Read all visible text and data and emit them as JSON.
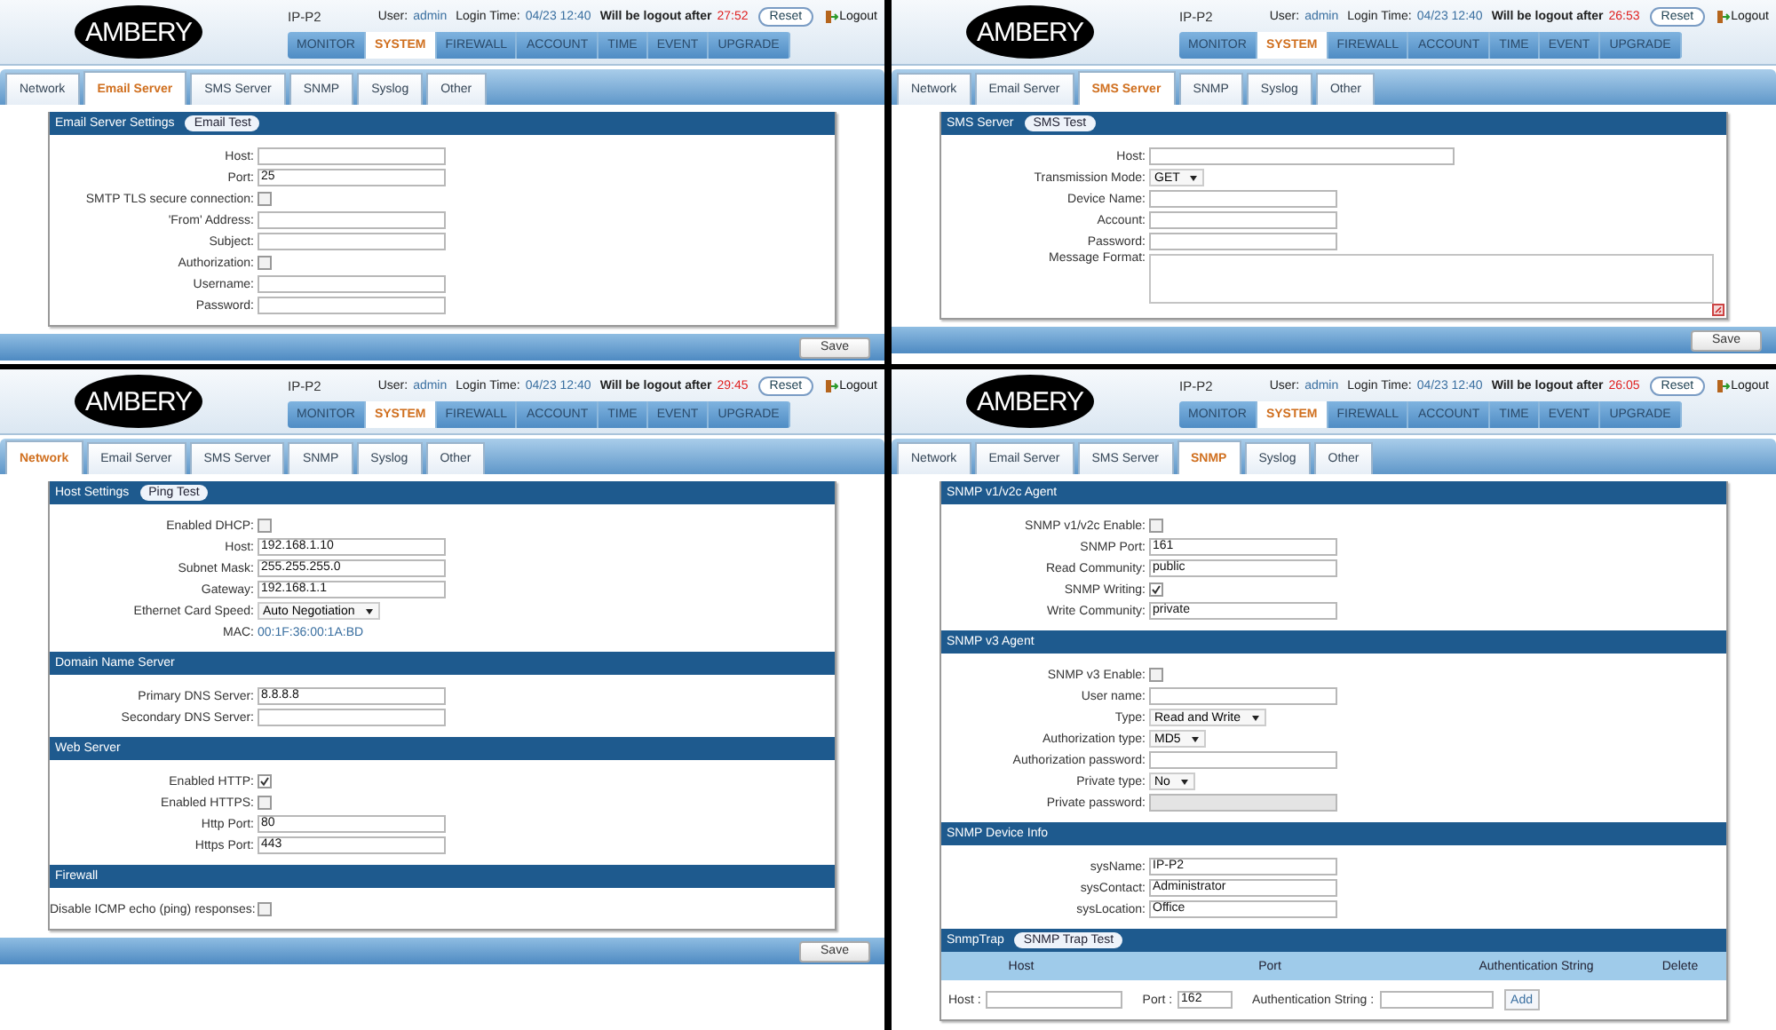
{
  "panels": [
    {
      "logo": "AMBERY",
      "product": "IP-P2",
      "user_label": "User:",
      "user": "admin",
      "login_label": "Login Time:",
      "login_time": "04/23 12:40",
      "logout_label": "Will be logout after",
      "countdown": "27:52",
      "reset": "Reset",
      "logout": "Logout",
      "menu": [
        {
          "label": "MONITOR",
          "selected": false
        },
        {
          "label": "SYSTEM",
          "selected": true
        },
        {
          "label": "FIREWALL",
          "selected": false
        },
        {
          "label": "ACCOUNT",
          "selected": false
        },
        {
          "label": "TIME",
          "selected": false
        },
        {
          "label": "EVENT",
          "selected": false
        },
        {
          "label": "UPGRADE",
          "selected": false
        }
      ],
      "tabs": [
        {
          "label": "Network",
          "selected": false
        },
        {
          "label": "Email Server",
          "selected": true
        },
        {
          "label": "SMS Server",
          "selected": false
        },
        {
          "label": "SNMP",
          "selected": false
        },
        {
          "label": "Syslog",
          "selected": false
        },
        {
          "label": "Other",
          "selected": false
        }
      ],
      "sections": [
        {
          "title": "Email Server Settings",
          "test_button": "Email Test",
          "rows": [
            {
              "kind": "text",
              "label": "Host:",
              "value": ""
            },
            {
              "kind": "text",
              "label": "Port:",
              "value": "25"
            },
            {
              "kind": "checkbox",
              "label": "SMTP TLS secure connection:",
              "checked": false
            },
            {
              "kind": "text",
              "label": "'From' Address:",
              "value": ""
            },
            {
              "kind": "text",
              "label": "Subject:",
              "value": ""
            },
            {
              "kind": "checkbox",
              "label": "Authorization:",
              "checked": false
            },
            {
              "kind": "text",
              "label": "Username:",
              "value": ""
            },
            {
              "kind": "text",
              "label": "Password:",
              "value": ""
            }
          ]
        }
      ],
      "save": "Save"
    },
    {
      "logo": "AMBERY",
      "product": "IP-P2",
      "user_label": "User:",
      "user": "admin",
      "login_label": "Login Time:",
      "login_time": "04/23 12:40",
      "logout_label": "Will be logout after",
      "countdown": "26:53",
      "reset": "Reset",
      "logout": "Logout",
      "menu": [
        {
          "label": "MONITOR",
          "selected": false
        },
        {
          "label": "SYSTEM",
          "selected": true
        },
        {
          "label": "FIREWALL",
          "selected": false
        },
        {
          "label": "ACCOUNT",
          "selected": false
        },
        {
          "label": "TIME",
          "selected": false
        },
        {
          "label": "EVENT",
          "selected": false
        },
        {
          "label": "UPGRADE",
          "selected": false
        }
      ],
      "tabs": [
        {
          "label": "Network",
          "selected": false
        },
        {
          "label": "Email Server",
          "selected": false
        },
        {
          "label": "SMS Server",
          "selected": true
        },
        {
          "label": "SNMP",
          "selected": false
        },
        {
          "label": "Syslog",
          "selected": false
        },
        {
          "label": "Other",
          "selected": false
        }
      ],
      "sections": [
        {
          "title": "SMS Server",
          "test_button": "SMS Test",
          "rows": [
            {
              "kind": "wide",
              "label": "Host:",
              "value": ""
            },
            {
              "kind": "select",
              "label": "Transmission Mode:",
              "value": "GET"
            },
            {
              "kind": "text",
              "label": "Device Name:",
              "value": ""
            },
            {
              "kind": "text",
              "label": "Account:",
              "value": ""
            },
            {
              "kind": "text",
              "label": "Password:",
              "value": ""
            },
            {
              "kind": "textarea",
              "label": "Message Format:",
              "value": ""
            }
          ]
        }
      ],
      "save": "Save"
    },
    {
      "logo": "AMBERY",
      "product": "IP-P2",
      "user_label": "User:",
      "user": "admin",
      "login_label": "Login Time:",
      "login_time": "04/23 12:40",
      "logout_label": "Will be logout after",
      "countdown": "29:45",
      "reset": "Reset",
      "logout": "Logout",
      "menu": [
        {
          "label": "MONITOR",
          "selected": false
        },
        {
          "label": "SYSTEM",
          "selected": true
        },
        {
          "label": "FIREWALL",
          "selected": false
        },
        {
          "label": "ACCOUNT",
          "selected": false
        },
        {
          "label": "TIME",
          "selected": false
        },
        {
          "label": "EVENT",
          "selected": false
        },
        {
          "label": "UPGRADE",
          "selected": false
        }
      ],
      "tabs": [
        {
          "label": "Network",
          "selected": true
        },
        {
          "label": "Email Server",
          "selected": false
        },
        {
          "label": "SMS Server",
          "selected": false
        },
        {
          "label": "SNMP",
          "selected": false
        },
        {
          "label": "Syslog",
          "selected": false
        },
        {
          "label": "Other",
          "selected": false
        }
      ],
      "sections": [
        {
          "title": "Host Settings",
          "test_button": "Ping Test",
          "rows": [
            {
              "kind": "checkbox",
              "label": "Enabled DHCP:",
              "checked": false
            },
            {
              "kind": "text",
              "label": "Host:",
              "value": "192.168.1.10"
            },
            {
              "kind": "text",
              "label": "Subnet Mask:",
              "value": "255.255.255.0"
            },
            {
              "kind": "text",
              "label": "Gateway:",
              "value": "192.168.1.1"
            },
            {
              "kind": "select",
              "label": "Ethernet Card Speed:",
              "value": "Auto Negotiation"
            },
            {
              "kind": "static",
              "label": "MAC:",
              "value": "00:1F:36:00:1A:BD"
            }
          ]
        },
        {
          "title": "Domain Name Server",
          "rows": [
            {
              "kind": "text",
              "label": "Primary DNS Server:",
              "value": "8.8.8.8"
            },
            {
              "kind": "text",
              "label": "Secondary DNS Server:",
              "value": ""
            }
          ]
        },
        {
          "title": "Web Server",
          "rows": [
            {
              "kind": "checkbox",
              "label": "Enabled HTTP:",
              "checked": true
            },
            {
              "kind": "checkbox",
              "label": "Enabled HTTPS:",
              "checked": false
            },
            {
              "kind": "text",
              "label": "Http Port:",
              "value": "80"
            },
            {
              "kind": "text",
              "label": "Https Port:",
              "value": "443"
            }
          ]
        },
        {
          "title": "Firewall",
          "rows": [
            {
              "kind": "checkbox",
              "label": "Disable ICMP echo (ping) responses:",
              "checked": false
            }
          ]
        }
      ],
      "save": "Save"
    },
    {
      "logo": "AMBERY",
      "product": "IP-P2",
      "user_label": "User:",
      "user": "admin",
      "login_label": "Login Time:",
      "login_time": "04/23 12:40",
      "logout_label": "Will be logout after",
      "countdown": "26:05",
      "reset": "Reset",
      "logout": "Logout",
      "menu": [
        {
          "label": "MONITOR",
          "selected": false
        },
        {
          "label": "SYSTEM",
          "selected": true
        },
        {
          "label": "FIREWALL",
          "selected": false
        },
        {
          "label": "ACCOUNT",
          "selected": false
        },
        {
          "label": "TIME",
          "selected": false
        },
        {
          "label": "EVENT",
          "selected": false
        },
        {
          "label": "UPGRADE",
          "selected": false
        }
      ],
      "tabs": [
        {
          "label": "Network",
          "selected": false
        },
        {
          "label": "Email Server",
          "selected": false
        },
        {
          "label": "SMS Server",
          "selected": false
        },
        {
          "label": "SNMP",
          "selected": true
        },
        {
          "label": "Syslog",
          "selected": false
        },
        {
          "label": "Other",
          "selected": false
        }
      ],
      "sections": [
        {
          "title": "SNMP v1/v2c Agent",
          "rows": [
            {
              "kind": "checkbox",
              "label": "SNMP v1/v2c Enable:",
              "checked": false
            },
            {
              "kind": "text",
              "label": "SNMP Port:",
              "value": "161"
            },
            {
              "kind": "text",
              "label": "Read Community:",
              "value": "public"
            },
            {
              "kind": "checkbox",
              "label": "SNMP Writing:",
              "checked": true
            },
            {
              "kind": "text",
              "label": "Write Community:",
              "value": "private"
            }
          ]
        },
        {
          "title": "SNMP v3 Agent",
          "rows": [
            {
              "kind": "checkbox",
              "label": "SNMP v3 Enable:",
              "checked": false
            },
            {
              "kind": "text",
              "label": "User name:",
              "value": ""
            },
            {
              "kind": "select",
              "label": "Type:",
              "value": "Read and Write"
            },
            {
              "kind": "select",
              "label": "Authorization type:",
              "value": "MD5"
            },
            {
              "kind": "text",
              "label": "Authorization password:",
              "value": ""
            },
            {
              "kind": "select",
              "label": "Private type:",
              "value": "No"
            },
            {
              "kind": "inactive",
              "label": "Private password:",
              "value": ""
            }
          ]
        },
        {
          "title": "SNMP Device Info",
          "rows": [
            {
              "kind": "text",
              "label": "sysName:",
              "value": "IP-P2"
            },
            {
              "kind": "text",
              "label": "sysContact:",
              "value": "Administrator"
            },
            {
              "kind": "text",
              "label": "sysLocation:",
              "value": "Office"
            }
          ]
        },
        {
          "title": "SnmpTrap",
          "test_button": "SNMP Trap Test",
          "table": {
            "columns": [
              "Host",
              "Port",
              "Authentication String",
              "Delete"
            ],
            "entry": {
              "host_label": "Host :",
              "port_label": "Port :",
              "port": "162",
              "auth_label": "Authentication String :",
              "add": "Add"
            }
          }
        }
      ]
    }
  ]
}
